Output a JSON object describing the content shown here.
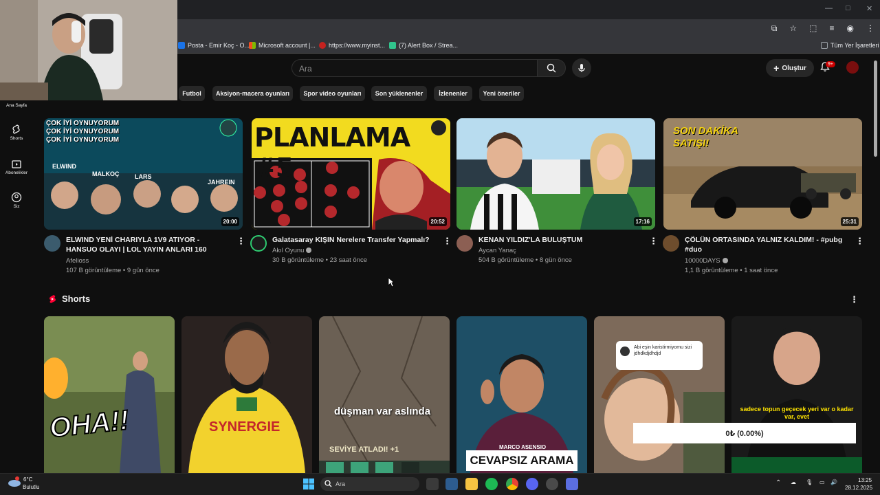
{
  "window": {
    "minimize": "—",
    "maximize": "□",
    "close": "✕"
  },
  "bookmarks": [
    {
      "label": "Posta - Emir Koç - O...",
      "color": "#1a73e8"
    },
    {
      "label": "Microsoft account |...",
      "color": "#f25022"
    },
    {
      "label": "https://www.myinst...",
      "color": "#c5221f"
    },
    {
      "label": "(7) Alert Box / Strea...",
      "color": "#31c48d"
    },
    {
      "label": "Tüm Yer İşaretleri",
      "color": "#9aa0a6"
    }
  ],
  "header": {
    "search_placeholder": "Ara",
    "create_label": "Oluştur",
    "notif_badge": "9+"
  },
  "chips": [
    "Futbol",
    "Aksiyon-macera oyunları",
    "Spor video oyunları",
    "Son yüklenenler",
    "İzlenenler",
    "Yeni öneriler"
  ],
  "sidebar": [
    {
      "label": "Ana Sayfa"
    },
    {
      "label": "Shorts"
    },
    {
      "label": "Abonelikler"
    },
    {
      "label": "Siz"
    }
  ],
  "videos": [
    {
      "title": "ELWIND YENİ CHARIYLA 1V9 ATIYOR - HANSUO OLAYI | LOL YAYIN ANLARI 160",
      "channel": "Afelioss",
      "meta": "107 B görüntüleme • 9 gün önce",
      "duration": "20:00",
      "verified": false
    },
    {
      "title": "Galatasaray KIŞIN Nerelere Transfer Yapmalı?",
      "channel": "Akıl Oyunu",
      "meta": "30 B görüntüleme • 23 saat önce",
      "duration": "20:52",
      "verified": true,
      "thumb_text": "PLANLAMA #5"
    },
    {
      "title": "KENAN YILDIZ'LA BULUŞTUM",
      "channel": "Aycan Yanaç",
      "meta": "504 B görüntüleme • 8 gün önce",
      "duration": "17:16",
      "verified": false
    },
    {
      "title": "ÇÖLÜN ORTASINDA YALNIZ KALDIM! - #pubg #duo",
      "channel": "10000DAYS",
      "meta": "1,1 B görüntüleme • 1 saat önce",
      "duration": "25:31",
      "verified": true,
      "thumb_text": "SON DAKİKA SATIŞI!"
    }
  ],
  "thumb1_lines": [
    "ÇOK İYİ OYNUYORUM",
    "ÇOK İYİ OYNUYORUM",
    "ÇOK İYİ OYNUYORUM"
  ],
  "thumb1_names": [
    "ELWIND",
    "MALKOÇ",
    "LARS",
    "JAHREIN"
  ],
  "shorts": {
    "title": "Shorts",
    "items": [
      {
        "caption": "OHA!!"
      },
      {
        "caption": "SYNERGIE"
      },
      {
        "caption": "düşman var aslında",
        "sub": "SEVİYE ATLADI! +1"
      },
      {
        "caption": "CEVAPSIZ ARAMA",
        "sub": "MARCO ASENSIO"
      },
      {
        "caption": "Abi eşin karistirmiyomu sizi",
        "sub": "jdhdkdjdhdjd"
      },
      {
        "caption": "sadece topun geçecek yeri var o kadar var, evet"
      }
    ]
  },
  "overlay": {
    "donation": "0₺ (0.00%)"
  },
  "taskbar": {
    "weather_temp": "6°C",
    "weather_desc": "Bulutlu",
    "search_placeholder": "Ara",
    "time": "13:25",
    "date": "28.12.2025"
  }
}
